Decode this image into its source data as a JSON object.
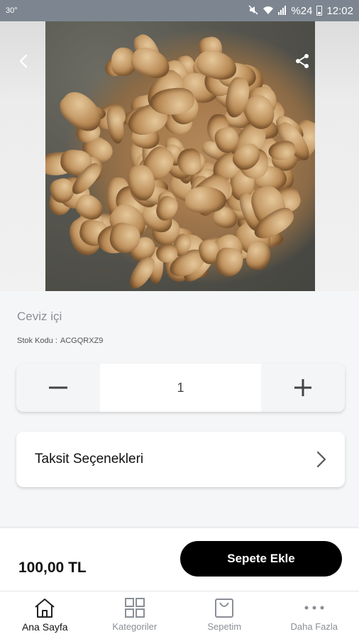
{
  "status_bar": {
    "temperature": "30°",
    "battery": "%24",
    "time": "12:02"
  },
  "product": {
    "name": "Ceviz içi",
    "sku_label": "Stok Kodu :",
    "sku": "ACGQRXZ9",
    "quantity": "1",
    "price": "100,00 TL"
  },
  "installments": {
    "label": "Taksit Seçenekleri"
  },
  "actions": {
    "add_to_cart": "Sepete Ekle"
  },
  "tabs": [
    {
      "label": "Ana Sayfa",
      "icon": "home-icon",
      "active": true
    },
    {
      "label": "Kategoriler",
      "icon": "grid-icon",
      "active": false
    },
    {
      "label": "Sepetim",
      "icon": "shopping-bag-icon",
      "active": false
    },
    {
      "label": "Daha Fazla",
      "icon": "more-icon",
      "active": false
    }
  ],
  "colors": {
    "status_bar": "#7d8690",
    "primary_button": "#000000",
    "background": "#f5f6f7"
  }
}
